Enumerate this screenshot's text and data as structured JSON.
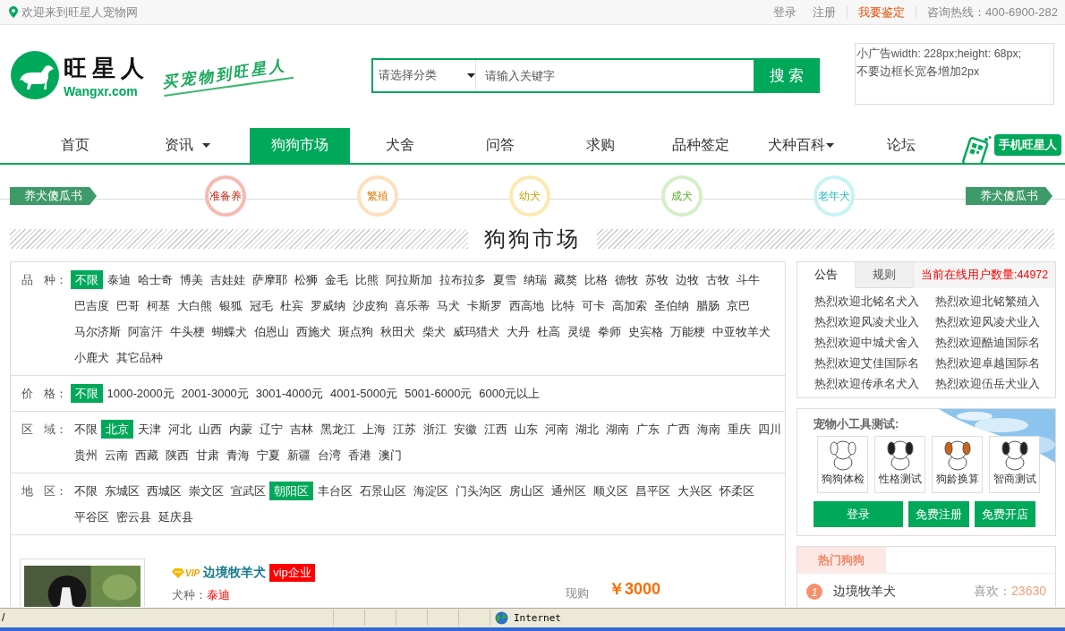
{
  "topbar": {
    "welcome": "欢迎来到旺星人宠物网",
    "links": [
      {
        "label": "登录",
        "kind": "normal"
      },
      {
        "label": "注册",
        "kind": "normal"
      },
      {
        "label": "我要鉴定",
        "kind": "highlight"
      }
    ],
    "hotline": "咨询热线：400-6900-282"
  },
  "header": {
    "logo_name": "旺星人",
    "logo_domain": "Wangxr.com",
    "slogan": "买宠物到旺星人",
    "search": {
      "category_placeholder": "请选择分类",
      "placeholder": "请输入关键字",
      "button": "搜 索"
    },
    "ad_lines": [
      "小广告width: 228px;height: 68px;",
      "不要边框长宽各增加2px"
    ]
  },
  "nav": [
    {
      "label": "首页",
      "selected": false,
      "dropdown": false
    },
    {
      "label": "资讯",
      "selected": false,
      "dropdown": true
    },
    {
      "label": "狗狗市场",
      "selected": true,
      "dropdown": false
    },
    {
      "label": "犬舍",
      "selected": false,
      "dropdown": false
    },
    {
      "label": "问答",
      "selected": false,
      "dropdown": false
    },
    {
      "label": "求购",
      "selected": false,
      "dropdown": false
    },
    {
      "label": "品种签定",
      "selected": false,
      "dropdown": false
    },
    {
      "label": "犬种百科",
      "selected": false,
      "dropdown": true
    },
    {
      "label": "论坛",
      "selected": false,
      "dropdown": false
    }
  ],
  "mobile_badge": "手机旺星人",
  "steps": {
    "start": "养犬傻瓜书",
    "end": "养犬傻瓜书",
    "stages": [
      {
        "label": "准备养",
        "color": "#f8b9b0"
      },
      {
        "label": "繁殖",
        "color": "#fde0bc"
      },
      {
        "label": "幼犬",
        "color": "#fde9b0"
      },
      {
        "label": "成犬",
        "color": "#d4efc6"
      },
      {
        "label": "老年犬",
        "color": "#c8f3f3"
      }
    ]
  },
  "section_title": "狗狗市场",
  "filters": [
    {
      "label": "品 种：",
      "options": [
        {
          "label": "不限",
          "selected": true
        },
        {
          "label": "泰迪",
          "selected": false
        },
        {
          "label": "哈士奇",
          "selected": false
        },
        {
          "label": "博美",
          "selected": false
        },
        {
          "label": "吉娃娃",
          "selected": false
        },
        {
          "label": "萨摩耶",
          "selected": false
        },
        {
          "label": "松狮",
          "selected": false
        },
        {
          "label": "金毛",
          "selected": false
        },
        {
          "label": "比熊",
          "selected": false
        },
        {
          "label": "阿拉斯加",
          "selected": false
        },
        {
          "label": "拉布拉多",
          "selected": false
        },
        {
          "label": "夏雪",
          "selected": false
        },
        {
          "label": "纳瑞",
          "selected": false
        },
        {
          "label": "藏獒",
          "selected": false
        },
        {
          "label": "比格",
          "selected": false
        },
        {
          "label": "德牧",
          "selected": false
        },
        {
          "label": "苏牧",
          "selected": false
        },
        {
          "label": "边牧",
          "selected": false
        },
        {
          "label": "古牧",
          "selected": false
        },
        {
          "label": "斗牛",
          "selected": false
        },
        {
          "label": "巴吉度",
          "selected": false
        },
        {
          "label": "巴哥",
          "selected": false
        },
        {
          "label": "柯基",
          "selected": false
        },
        {
          "label": "大白熊",
          "selected": false
        },
        {
          "label": "银狐",
          "selected": false
        },
        {
          "label": "冠毛",
          "selected": false
        },
        {
          "label": "杜宾",
          "selected": false
        },
        {
          "label": "罗威纳",
          "selected": false
        },
        {
          "label": "沙皮狗",
          "selected": false
        },
        {
          "label": "喜乐蒂",
          "selected": false
        },
        {
          "label": "马犬",
          "selected": false
        },
        {
          "label": "卡斯罗",
          "selected": false
        },
        {
          "label": "西高地",
          "selected": false
        },
        {
          "label": "比特",
          "selected": false
        },
        {
          "label": "可卡",
          "selected": false
        },
        {
          "label": "高加索",
          "selected": false
        },
        {
          "label": "圣伯纳",
          "selected": false
        },
        {
          "label": "腊肠",
          "selected": false
        },
        {
          "label": "京巴",
          "selected": false
        },
        {
          "label": "马尔济斯",
          "selected": false
        },
        {
          "label": "阿富汗",
          "selected": false
        },
        {
          "label": "牛头梗",
          "selected": false
        },
        {
          "label": "蝴蝶犬",
          "selected": false
        },
        {
          "label": "伯恩山",
          "selected": false
        },
        {
          "label": "西施犬",
          "selected": false
        },
        {
          "label": "斑点狗",
          "selected": false
        },
        {
          "label": "秋田犬",
          "selected": false
        },
        {
          "label": "柴犬",
          "selected": false
        },
        {
          "label": "威玛猎犬",
          "selected": false
        },
        {
          "label": "大丹",
          "selected": false
        },
        {
          "label": "杜高",
          "selected": false
        },
        {
          "label": "灵缇",
          "selected": false
        },
        {
          "label": "拳师",
          "selected": false
        },
        {
          "label": "史宾格",
          "selected": false
        },
        {
          "label": "万能梗",
          "selected": false
        },
        {
          "label": "中亚牧羊犬",
          "selected": false
        },
        {
          "label": "小鹿犬",
          "selected": false
        },
        {
          "label": "其它品种",
          "selected": false
        }
      ]
    },
    {
      "label": "价 格：",
      "options": [
        {
          "label": "不限",
          "selected": true
        },
        {
          "label": "1000-2000元",
          "selected": false
        },
        {
          "label": "2001-3000元",
          "selected": false
        },
        {
          "label": "3001-4000元",
          "selected": false
        },
        {
          "label": "4001-5000元",
          "selected": false
        },
        {
          "label": "5001-6000元",
          "selected": false
        },
        {
          "label": "6000元以上",
          "selected": false
        }
      ]
    },
    {
      "label": "区 域：",
      "options": [
        {
          "label": "不限",
          "selected": false
        },
        {
          "label": "北京",
          "selected": true
        },
        {
          "label": "天津",
          "selected": false
        },
        {
          "label": "河北",
          "selected": false
        },
        {
          "label": "山西",
          "selected": false
        },
        {
          "label": "内蒙",
          "selected": false
        },
        {
          "label": "辽宁",
          "selected": false
        },
        {
          "label": "吉林",
          "selected": false
        },
        {
          "label": "黑龙江",
          "selected": false
        },
        {
          "label": "上海",
          "selected": false
        },
        {
          "label": "江苏",
          "selected": false
        },
        {
          "label": "浙江",
          "selected": false
        },
        {
          "label": "安徽",
          "selected": false
        },
        {
          "label": "江西",
          "selected": false
        },
        {
          "label": "山东",
          "selected": false
        },
        {
          "label": "河南",
          "selected": false
        },
        {
          "label": "湖北",
          "selected": false
        },
        {
          "label": "湖南",
          "selected": false
        },
        {
          "label": "广东",
          "selected": false
        },
        {
          "label": "广西",
          "selected": false
        },
        {
          "label": "海南",
          "selected": false
        },
        {
          "label": "重庆",
          "selected": false
        },
        {
          "label": "四川",
          "selected": false
        },
        {
          "label": "贵州",
          "selected": false
        },
        {
          "label": "云南",
          "selected": false
        },
        {
          "label": "西藏",
          "selected": false
        },
        {
          "label": "陕西",
          "selected": false
        },
        {
          "label": "甘肃",
          "selected": false
        },
        {
          "label": "青海",
          "selected": false
        },
        {
          "label": "宁夏",
          "selected": false
        },
        {
          "label": "新疆",
          "selected": false
        },
        {
          "label": "台湾",
          "selected": false
        },
        {
          "label": "香港",
          "selected": false
        },
        {
          "label": "澳门",
          "selected": false
        }
      ]
    },
    {
      "label": "地 区：",
      "options": [
        {
          "label": "不限",
          "selected": false
        },
        {
          "label": "东城区",
          "selected": false
        },
        {
          "label": "西城区",
          "selected": false
        },
        {
          "label": "崇文区",
          "selected": false
        },
        {
          "label": "宣武区",
          "selected": false
        },
        {
          "label": "朝阳区",
          "selected": true
        },
        {
          "label": "丰台区",
          "selected": false
        },
        {
          "label": "石景山区",
          "selected": false
        },
        {
          "label": "海淀区",
          "selected": false
        },
        {
          "label": "门头沟区",
          "selected": false
        },
        {
          "label": "房山区",
          "selected": false
        },
        {
          "label": "通州区",
          "selected": false
        },
        {
          "label": "顺义区",
          "selected": false
        },
        {
          "label": "昌平区",
          "selected": false
        },
        {
          "label": "大兴区",
          "selected": false
        },
        {
          "label": "怀柔区",
          "selected": false
        },
        {
          "label": "平谷区",
          "selected": false
        },
        {
          "label": "密云县",
          "selected": false
        },
        {
          "label": "延庆县",
          "selected": false
        }
      ]
    }
  ],
  "listing": {
    "vip_mark": "VIP",
    "title": "边境牧羊犬",
    "badge": "vip企业",
    "breed_label": "犬种：",
    "breed": "泰迪",
    "price_label": "现购",
    "price": "￥3000"
  },
  "notice": {
    "tabs": [
      {
        "label": "公告",
        "selected": true
      },
      {
        "label": "规则",
        "selected": false
      }
    ],
    "online": "当前在线用户数量:44972",
    "items": [
      "热烈欢迎北铭名犬入",
      "热烈欢迎北铭繁殖入",
      "热烈欢迎风凌犬业入",
      "热烈欢迎风凌犬业入",
      "热烈欢迎中城犬舍入",
      "热烈欢迎酷迪国际名",
      "热烈欢迎艾佳国际名",
      "热烈欢迎卓越国际名",
      "热烈欢迎传承名犬入",
      "热烈欢迎伍岳犬业入"
    ]
  },
  "tools": {
    "title": "宠物小工具测试:",
    "items": [
      "狗狗体检",
      "性格测试",
      "狗龄换算",
      "智商测试"
    ],
    "buttons": [
      "登录",
      "免费注册",
      "免费开店"
    ]
  },
  "hot": {
    "tab": "热门狗狗",
    "items": [
      {
        "rank": "1",
        "name": "边境牧羊犬",
        "likes_label": "喜欢：",
        "likes": "23630"
      }
    ]
  },
  "status_bar": {
    "text": "/",
    "zone": "Internet"
  }
}
